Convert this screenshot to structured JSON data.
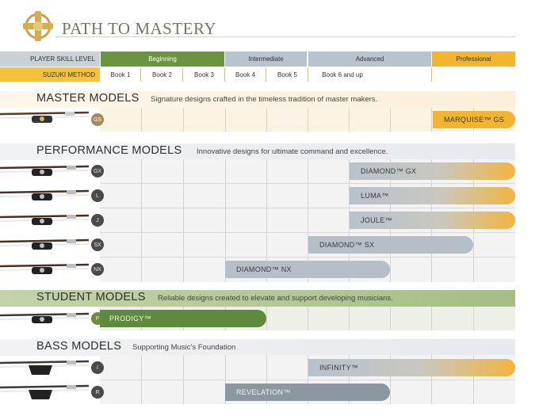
{
  "title": "PATH TO MASTERY",
  "header": {
    "skill_label": "PLAYER SKILL LEVEL",
    "suzuki_label": "SUZUKI METHOD",
    "levels": [
      "Beginning",
      "Intermediate",
      "Advanced",
      "Professional"
    ],
    "books": [
      "Book 1",
      "Book 2",
      "Book 3",
      "Book 4",
      "Book 5",
      "Book 6 and up"
    ]
  },
  "colors": {
    "beginning": "#6a9440",
    "intermediate": "#b9c3cf",
    "advanced": "#b9c3cf",
    "professional": "#f3b530",
    "suzuki_row": "#f7c13b",
    "master_band": "#fbf1df",
    "student_band": "#a7bd84",
    "performance_band": "#e9ecef",
    "bass_band": "#e9ecef"
  },
  "sections": {
    "master": {
      "title": "MASTER MODELS",
      "subtitle": "Signature designs crafted in the timeless tradition of master makers.",
      "models": [
        {
          "code": "GS",
          "name": "MARQUISE™ GS"
        }
      ]
    },
    "performance": {
      "title": "PERFORMANCE MODELS",
      "subtitle": "Innovative designs for ultimate command and excellence.",
      "models": [
        {
          "code": "GX",
          "name": "DIAMOND™ GX"
        },
        {
          "code": "L",
          "name": "LUMA™"
        },
        {
          "code": "J",
          "name": "JOULE™"
        },
        {
          "code": "SX",
          "name": "DIAMOND™ SX"
        },
        {
          "code": "NX",
          "name": "DIAMOND™ NX"
        }
      ]
    },
    "student": {
      "title": "STUDENT MODELS",
      "subtitle": "Reliable designs created to elevate and support developing musicians.",
      "models": [
        {
          "code": "P",
          "name": "PRODIGY™"
        }
      ]
    },
    "bass": {
      "title": "BASS MODELS",
      "subtitle": "Supporting Music’s Foundation",
      "models": [
        {
          "code": "I",
          "name": "INFINITY™"
        },
        {
          "code": "R",
          "name": "REVELATION™"
        }
      ]
    }
  }
}
